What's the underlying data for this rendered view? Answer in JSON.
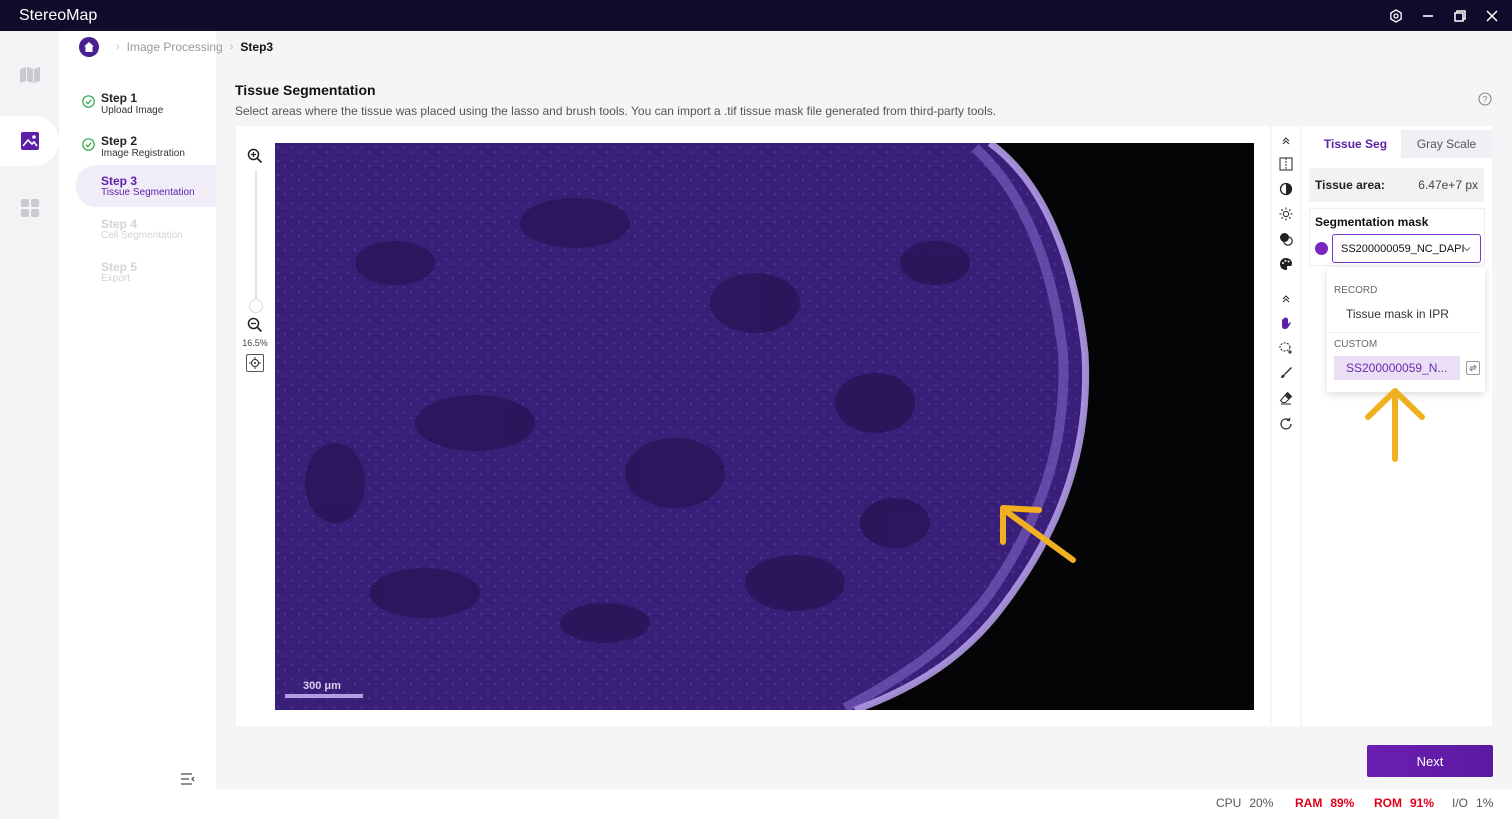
{
  "app": {
    "title": "StereoMap"
  },
  "breadcrumb": {
    "items": [
      "Image Processing"
    ],
    "current": "Step3"
  },
  "steps": [
    {
      "title": "Step 1",
      "desc": "Upload Image",
      "state": "done"
    },
    {
      "title": "Step 2",
      "desc": "Image Registration",
      "state": "done"
    },
    {
      "title": "Step 3",
      "desc": "Tissue Segmentation",
      "state": "active"
    },
    {
      "title": "Step 4",
      "desc": "Cell Segmentation",
      "state": "disabled"
    },
    {
      "title": "Step 5",
      "desc": "Export",
      "state": "disabled"
    }
  ],
  "page": {
    "title": "Tissue Segmentation",
    "description": "Select areas where the tissue was placed using the lasso and brush tools. You can import a .tif tissue mask file generated from third-party tools."
  },
  "viewer": {
    "zoom": "16.5%",
    "scalebar": "300 μm"
  },
  "panel": {
    "tabs": [
      {
        "label": "Tissue Seg",
        "active": true
      },
      {
        "label": "Gray Scale",
        "active": false
      }
    ],
    "tissue_area_label": "Tissue area:",
    "tissue_area_value": "6.47e+7 px",
    "segmentation_mask_label": "Segmentation mask",
    "selected_mask": "SS200000059_NC_DAPI",
    "mask_color": "#7a26c1",
    "dropdown": {
      "record_header": "RECORD",
      "record_items": [
        "Tissue mask in IPR"
      ],
      "custom_header": "CUSTOM",
      "custom_items": [
        "SS200000059_N..."
      ]
    }
  },
  "actions": {
    "next_label": "Next"
  },
  "status": {
    "cpu_label": "CPU",
    "cpu_value": "20%",
    "ram_label": "RAM",
    "ram_value": "89%",
    "rom_label": "ROM",
    "rom_value": "91%",
    "io_label": "I/O",
    "io_value": "1%"
  },
  "colors": {
    "accent": "#5d1fa8",
    "titlebar": "#110c2c",
    "annotation_arrow": "#f0b020",
    "warning": "#e0001b"
  }
}
